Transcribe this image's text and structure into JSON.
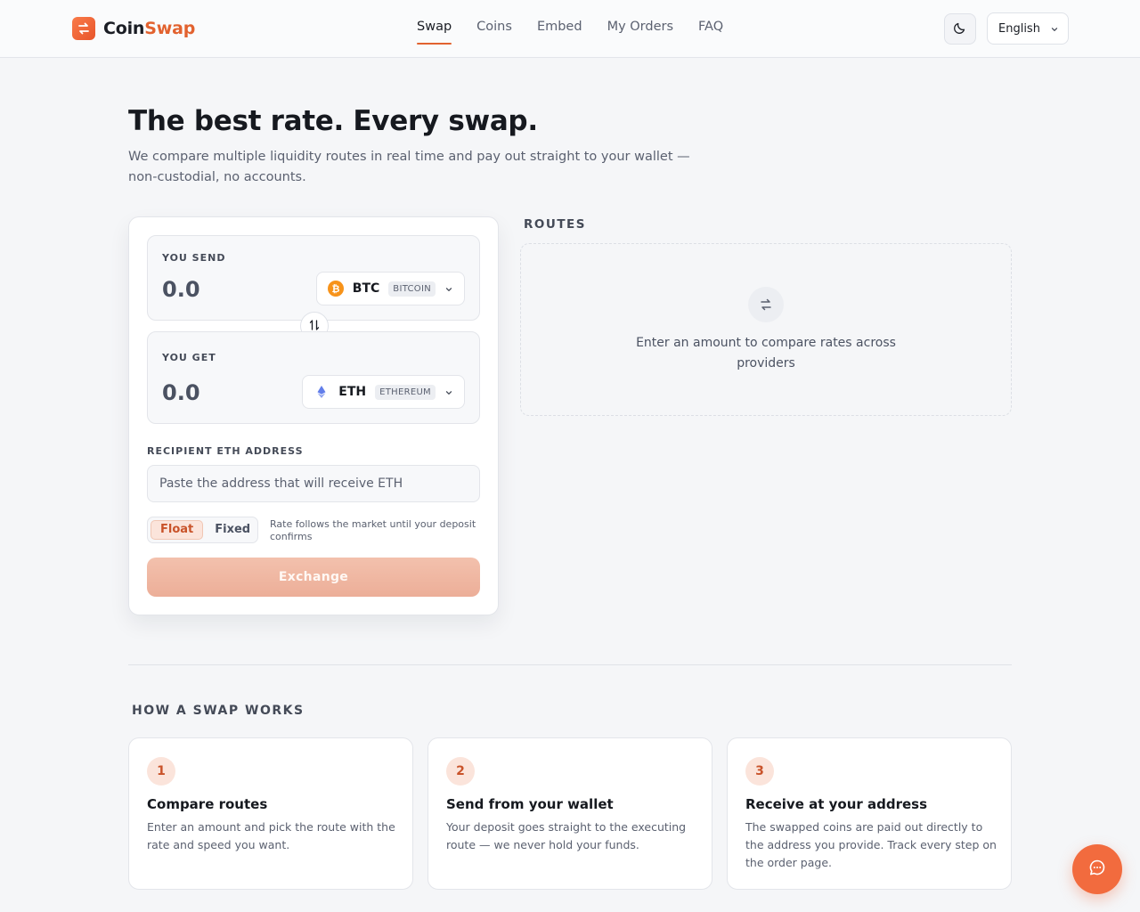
{
  "header": {
    "logo_part1": "Coin",
    "logo_part2": "Swap",
    "nav": [
      "Swap",
      "Coins",
      "Embed",
      "My Orders",
      "FAQ"
    ],
    "active_nav": "Swap",
    "language": "English"
  },
  "hero": {
    "title": "The best rate. Every swap.",
    "subtitle": "We compare multiple liquidity routes in real time and pay out straight to your wallet — non-custodial, no accounts."
  },
  "swap": {
    "send": {
      "label": "YOU SEND",
      "amount": "0.0",
      "ticker": "BTC",
      "name": "BITCOIN",
      "icon": "bitcoin-icon",
      "color": "#f7931a"
    },
    "get": {
      "label": "YOU GET",
      "amount": "0.0",
      "ticker": "ETH",
      "name": "ETHEREUM",
      "icon": "ethereum-icon",
      "color": "#627eea"
    },
    "recipient_label": "RECIPIENT ETH ADDRESS",
    "recipient_placeholder": "Paste the address that will receive ETH",
    "rate_options": [
      "Float",
      "Fixed"
    ],
    "rate_selected": "Float",
    "rate_hint": "Rate follows the market until your deposit confirms",
    "exchange_label": "Exchange"
  },
  "routes": {
    "title": "ROUTES",
    "empty_message": "Enter an amount to compare rates across providers"
  },
  "how": {
    "title": "HOW A SWAP WORKS",
    "steps": [
      {
        "num": "1",
        "title": "Compare routes",
        "body": "Enter an amount and pick the route with the rate and speed you want."
      },
      {
        "num": "2",
        "title": "Send from your wallet",
        "body": "Your deposit goes straight to the executing route — we never hold your funds."
      },
      {
        "num": "3",
        "title": "Receive at your address",
        "body": "The swapped coins are paid out directly to the address you provide. Track every step on the order page."
      }
    ]
  },
  "colors": {
    "accent": "#e2622f",
    "accent_soft": "#fbe4db"
  }
}
